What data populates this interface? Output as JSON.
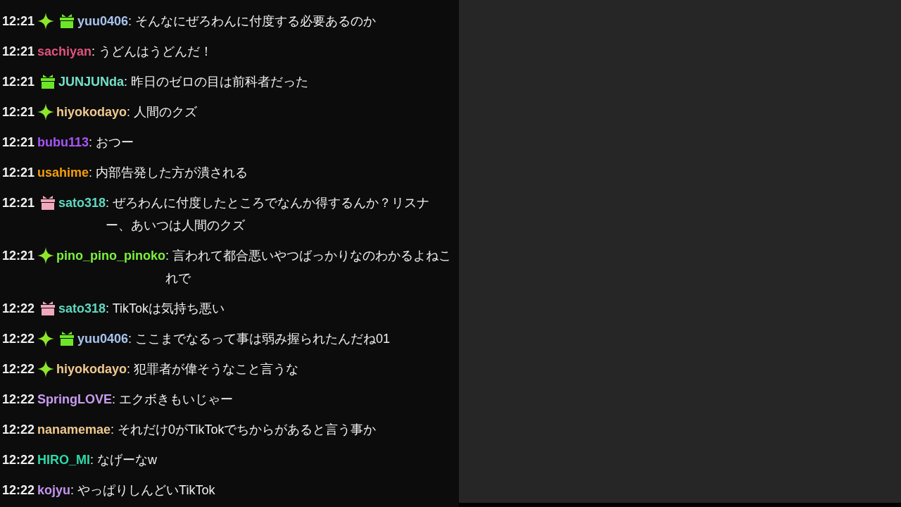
{
  "chat": {
    "messages": [
      {
        "time": "12:21",
        "badges": [
          {
            "kind": "sparkle",
            "color": "#8ee62a"
          },
          {
            "kind": "gift",
            "color": "#6ee628"
          }
        ],
        "name": "yuu0406",
        "color": "#a9c3ee",
        "message": ": そんなにぜろわんに付度する必要あるのか"
      },
      {
        "time": "12:21",
        "name": "sachiyan",
        "color": "#e0537e",
        "message": ": うどんはうどんだ！"
      },
      {
        "time": "12:21",
        "badges": [
          {
            "kind": "gift",
            "color": "#6ee628"
          }
        ],
        "name": "JUNJUNda",
        "color": "#72e0c8",
        "message": ": 昨日のゼロの目は前科者だった"
      },
      {
        "time": "12:21",
        "badges": [
          {
            "kind": "sparkle",
            "color": "#8ee62a"
          }
        ],
        "name": "hiyokodayo",
        "color": "#f0c98e",
        "message": ": 人間のクズ"
      },
      {
        "time": "12:21",
        "name": "bubu113",
        "color": "#a855f7",
        "message": ": おつー"
      },
      {
        "time": "12:21",
        "name": "usahime",
        "color": "#f59e0b",
        "message": ": 内部告発した方が潰される"
      },
      {
        "time": "12:21",
        "badges": [
          {
            "kind": "gift",
            "color": "#f0a8bc"
          }
        ],
        "name": "sato318",
        "color": "#5fd8c0",
        "message": ": ぜろわんに付度したところでなんか得するんか？リスナー、あいつは人間のクズ"
      },
      {
        "time": "12:21",
        "badges": [
          {
            "kind": "sparkle",
            "color": "#8ee62a"
          }
        ],
        "name": "pino_pino_pinoko",
        "color": "#7cf03c",
        "message": ": 言われて都合悪いやつばっかりなのわかるよねこれで"
      },
      {
        "time": "12:22",
        "badges": [
          {
            "kind": "gift",
            "color": "#f0a8bc"
          }
        ],
        "name": "sato318",
        "color": "#5ed8c0",
        "message": ": TikTokは気持ち悪い"
      },
      {
        "time": "12:22",
        "badges": [
          {
            "kind": "sparkle",
            "color": "#8ee62a"
          },
          {
            "kind": "gift",
            "color": "#6ee628"
          }
        ],
        "name": "yuu0406",
        "color": "#a8c3ee",
        "message": ": ここまでなるって事は弱み握られたんだね01"
      },
      {
        "time": "12:22",
        "badges": [
          {
            "kind": "sparkle",
            "color": "#8ee62a"
          }
        ],
        "name": "hiyokodayo",
        "color": "#f0c98f",
        "message": ": 犯罪者が偉そうなこと言うな"
      },
      {
        "time": "12:22",
        "name": "SpringLOVE",
        "color": "#c99cf0",
        "message": ": エクボきもいじゃー"
      },
      {
        "time": "12:22",
        "name": "nanamemae",
        "color": "#f0c88e",
        "message": ": それだけ0がTikTokでちからがあると言う事か"
      },
      {
        "time": "12:22",
        "name": "HIRO_MI",
        "color": "#2ed8a8",
        "message": ": なげーなw"
      },
      {
        "time": "12:22",
        "name": "kojyu",
        "color": "#c394f0",
        "message": ": やっぱりしんどいTikTok"
      }
    ]
  }
}
